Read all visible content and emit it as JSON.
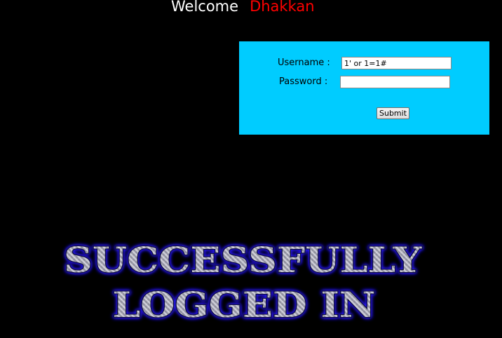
{
  "header": {
    "welcome_label": "Welcome",
    "user_name": "Dhakkan"
  },
  "login_form": {
    "username_label": "Username :",
    "username_value": "1' or 1=1#",
    "password_label": "Password :",
    "password_value": "",
    "submit_label": "Submit"
  },
  "banner": {
    "line1": "SUCCESSFULLY",
    "line2": "LOGGED IN"
  },
  "colors": {
    "background": "#000000",
    "welcome_text": "#ffffff",
    "user_name": "#ff0000",
    "form_background": "#00ccff",
    "banner_glow": "#2a1cff",
    "banner_fill": "#9a9aa8"
  }
}
